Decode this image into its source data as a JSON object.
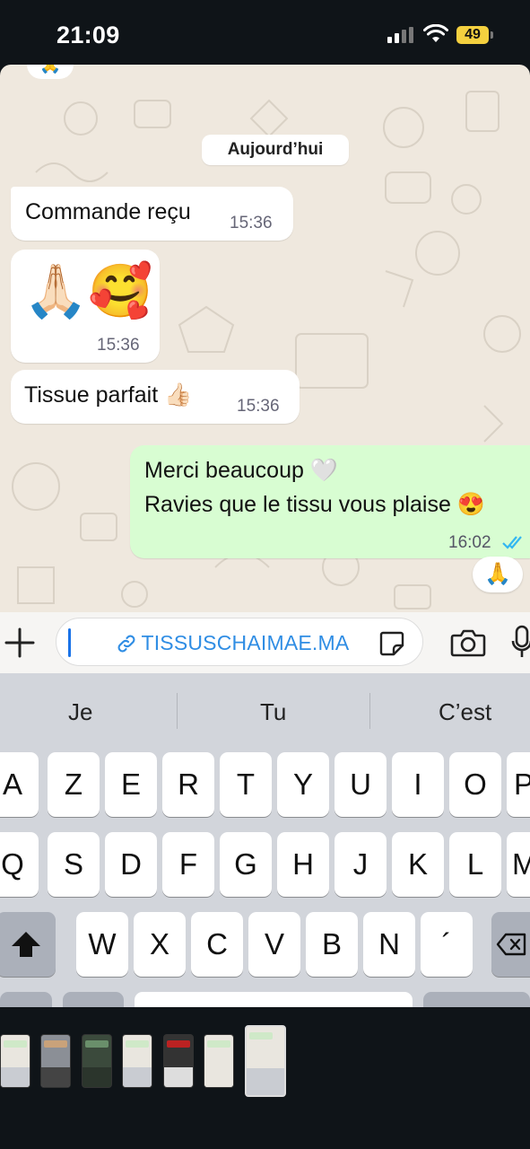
{
  "status_bar": {
    "time": "21:09",
    "battery": "49"
  },
  "chat": {
    "top_reaction": "🙏",
    "date_label": "Aujourd’hui",
    "messages": [
      {
        "direction": "in",
        "text": "Commande reçu",
        "time": "15:36"
      },
      {
        "direction": "in",
        "text": "🙏🏻🥰",
        "time": "15:36"
      },
      {
        "direction": "in",
        "text": "Tissue parfait 👍🏻",
        "time": "15:36"
      },
      {
        "direction": "out",
        "line1": "Merci beaucoup 🤍",
        "line2": "Ravies que le tissu vous plaise 😍",
        "time": "16:02",
        "status": "read"
      }
    ],
    "reaction": "🙏"
  },
  "composer": {
    "link_text": "TISSUSCHAIMAE.MA"
  },
  "keyboard": {
    "suggestions": [
      "Je",
      "Tu",
      "C’est"
    ],
    "row1": [
      "A",
      "Z",
      "E",
      "R",
      "T",
      "Y",
      "U",
      "I",
      "O",
      "P"
    ],
    "row2": [
      "Q",
      "S",
      "D",
      "F",
      "G",
      "H",
      "J",
      "K",
      "L",
      "M"
    ],
    "row3": [
      "W",
      "X",
      "C",
      "V",
      "B",
      "N",
      "´"
    ]
  },
  "colors": {
    "outgoing_bubble": "#d8fdd2",
    "chat_bg": "#efe8de",
    "link": "#2f8de4",
    "read_ticks": "#34b7f1"
  }
}
